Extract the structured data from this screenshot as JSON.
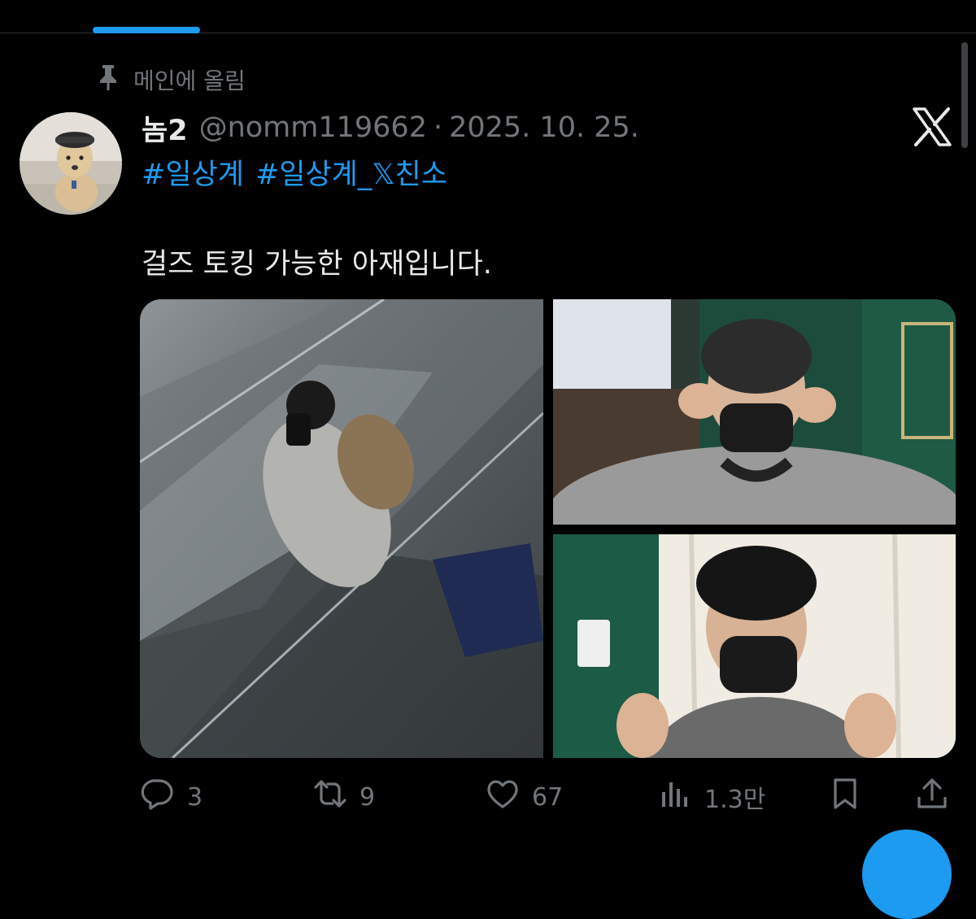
{
  "pinned": {
    "label": "메인에 올림"
  },
  "tweet": {
    "display_name": "놈2",
    "handle": "@nomm119662",
    "separator": "·",
    "date": "2025. 10. 25.",
    "hashtags": [
      "#일상계",
      "#일상계_𝕏친소"
    ],
    "text": "걸즈 토킹 가능한 아재입니다."
  },
  "actions": {
    "reply_count": "3",
    "retweet_count": "9",
    "like_count": "67",
    "views_count": "1.3만"
  },
  "media": {
    "count": 3,
    "icons": [
      "elevator-mirror-selfie",
      "heart-hands-photo",
      "finger-heart-photo"
    ]
  },
  "colors": {
    "accent": "#1d9bf0",
    "secondary_text": "#71767b",
    "primary_text": "#e7e9ea",
    "background": "#000000"
  }
}
